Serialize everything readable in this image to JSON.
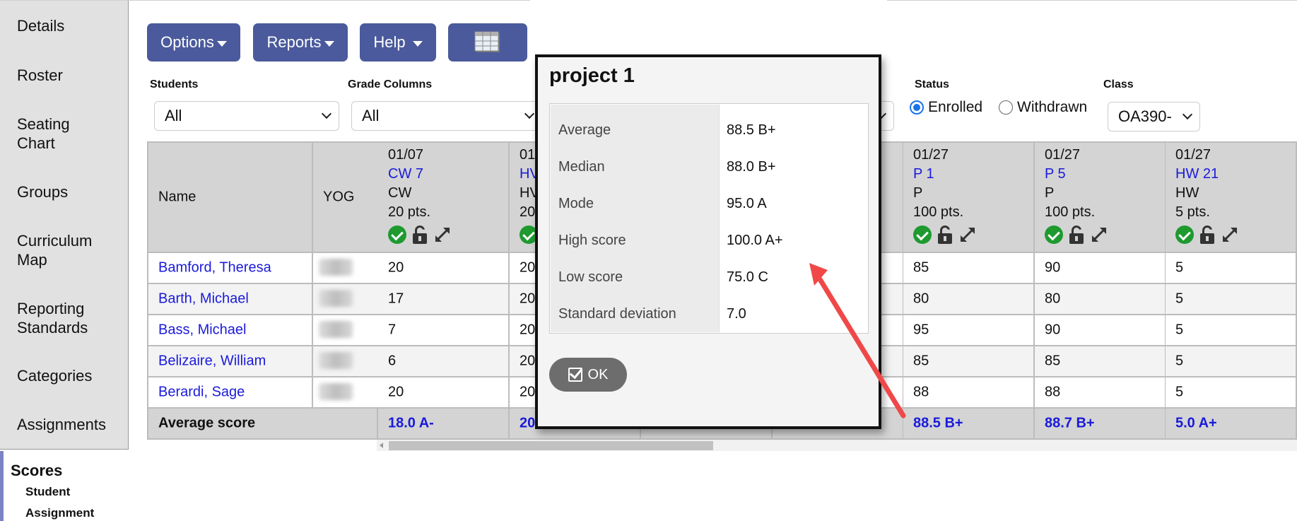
{
  "sidebar": {
    "items": [
      {
        "label": "Details"
      },
      {
        "label": "Roster"
      },
      {
        "label": "Seating Chart"
      },
      {
        "label": "Groups"
      },
      {
        "label": "Curriculum Map"
      },
      {
        "label": "Reporting Standards"
      },
      {
        "label": "Categories"
      },
      {
        "label": "Assignments"
      }
    ],
    "scores": {
      "title": "Scores",
      "sub": [
        "Student",
        "Assignment"
      ]
    },
    "accent": "#7b83c4"
  },
  "toolbar": {
    "options_label": "Options",
    "reports_label": "Reports",
    "help_label": "Help",
    "grid_icon": "table-grid-icon",
    "button_color": "#4a5a9c"
  },
  "filters": {
    "students_label": "Students",
    "students_value": "All",
    "grade_columns_label": "Grade Columns",
    "grade_columns_value": "All",
    "status_label": "Status",
    "status_options": [
      "Enrolled",
      "Withdrawn"
    ],
    "status_selected": "Enrolled",
    "class_label": "Class",
    "class_value": "OA390-"
  },
  "table": {
    "name_header": "Name",
    "yog_header": "YOG",
    "columns": [
      {
        "date": "01/07",
        "assignment": "CW 7",
        "category": "CW",
        "points": "20 pts.",
        "average": "18.0 A-",
        "scores": [
          "20",
          "17",
          "7",
          "6",
          "20"
        ]
      },
      {
        "date": "01",
        "assignment": "HV",
        "category": "HV",
        "points": "20",
        "average": "20.",
        "scores": [
          "20",
          "20",
          "20",
          "20",
          "20"
        ]
      },
      {
        "date": "",
        "assignment": "",
        "category": "",
        "points": "",
        "average": "",
        "scores": [
          "",
          "",
          "",
          "",
          ""
        ]
      },
      {
        "date": "",
        "assignment": "",
        "category": "",
        "points": "",
        "average": "",
        "scores": [
          "",
          "",
          "",
          "",
          ""
        ]
      },
      {
        "date": "01/27",
        "assignment": "P 1",
        "category": "P",
        "points": "100 pts.",
        "average": "88.5 B+",
        "scores": [
          "85",
          "80",
          "95",
          "85",
          "88"
        ]
      },
      {
        "date": "01/27",
        "assignment": "P 5",
        "category": "P",
        "points": "100 pts.",
        "average": "88.7 B+",
        "scores": [
          "90",
          "80",
          "90",
          "85",
          "88"
        ]
      },
      {
        "date": "01/27",
        "assignment": "HW 21",
        "category": "HW",
        "points": "5 pts.",
        "average": "5.0 A+",
        "scores": [
          "5",
          "5",
          "5",
          "5",
          "5"
        ]
      }
    ],
    "students": [
      {
        "name": "Bamford, Theresa",
        "yog": "2026"
      },
      {
        "name": "Barth, Michael",
        "yog": "2026"
      },
      {
        "name": "Bass, Michael",
        "yog": "2026"
      },
      {
        "name": "Belizaire, William",
        "yog": "2026"
      },
      {
        "name": "Berardi, Sage",
        "yog": "2026"
      }
    ],
    "footer_label": "Average score",
    "header_icons": [
      "check-circle-icon",
      "unlock-icon",
      "expand-icon"
    ]
  },
  "dialog": {
    "title": "project 1",
    "stats": [
      {
        "label": "Average",
        "value": "88.5 B+"
      },
      {
        "label": "Median",
        "value": "88.0 B+"
      },
      {
        "label": "Mode",
        "value": "95.0 A"
      },
      {
        "label": "High score",
        "value": "100.0 A+"
      },
      {
        "label": "Low score",
        "value": "75.0 C"
      },
      {
        "label": "Standard deviation",
        "value": "7.0"
      }
    ],
    "ok_label": "OK"
  },
  "annotation": {
    "arrow_color": "#f04848"
  }
}
